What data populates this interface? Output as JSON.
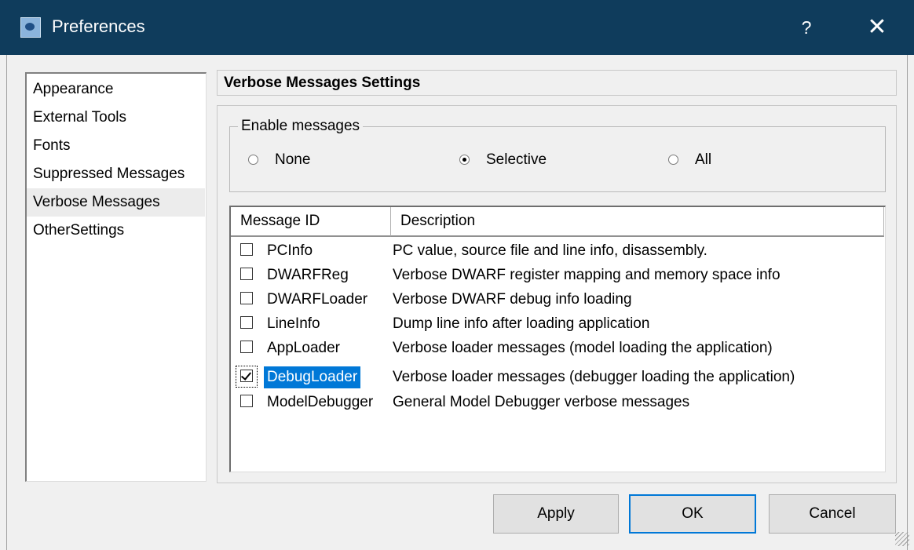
{
  "window": {
    "title": "Preferences",
    "help_label": "?",
    "close_label": "✕"
  },
  "nav": {
    "items": [
      {
        "label": "Appearance"
      },
      {
        "label": "External Tools"
      },
      {
        "label": "Fonts"
      },
      {
        "label": "Suppressed Messages"
      },
      {
        "label": "Verbose Messages",
        "selected": true
      },
      {
        "label": "OtherSettings"
      }
    ]
  },
  "section": {
    "title": "Verbose Messages Settings"
  },
  "enable_messages": {
    "legend": "Enable messages",
    "options": [
      {
        "label": "None",
        "checked": false
      },
      {
        "label": "Selective",
        "checked": true
      },
      {
        "label": "All",
        "checked": false
      }
    ]
  },
  "table": {
    "columns": [
      "Message ID",
      "Description"
    ],
    "rows": [
      {
        "id": "PCInfo",
        "description": "PC value, source file and line info, disassembly.",
        "checked": false
      },
      {
        "id": "DWARFReg",
        "description": "Verbose DWARF register mapping and memory space info",
        "checked": false
      },
      {
        "id": "DWARFLoader",
        "description": "Verbose DWARF debug info loading",
        "checked": false
      },
      {
        "id": "LineInfo",
        "description": "Dump line info after loading application",
        "checked": false
      },
      {
        "id": "AppLoader",
        "description": "Verbose loader messages (model loading the application)",
        "checked": false
      },
      {
        "id": "DebugLoader",
        "description": "Verbose loader messages (debugger loading the application)",
        "checked": true,
        "selected": true
      },
      {
        "id": "ModelDebugger",
        "description": "General Model Debugger verbose messages",
        "checked": false
      }
    ]
  },
  "buttons": {
    "apply": "Apply",
    "ok": "OK",
    "cancel": "Cancel"
  },
  "colors": {
    "titlebar": "#0f3c5c",
    "selection": "#0078d7",
    "default_button_border": "#0078d7"
  }
}
